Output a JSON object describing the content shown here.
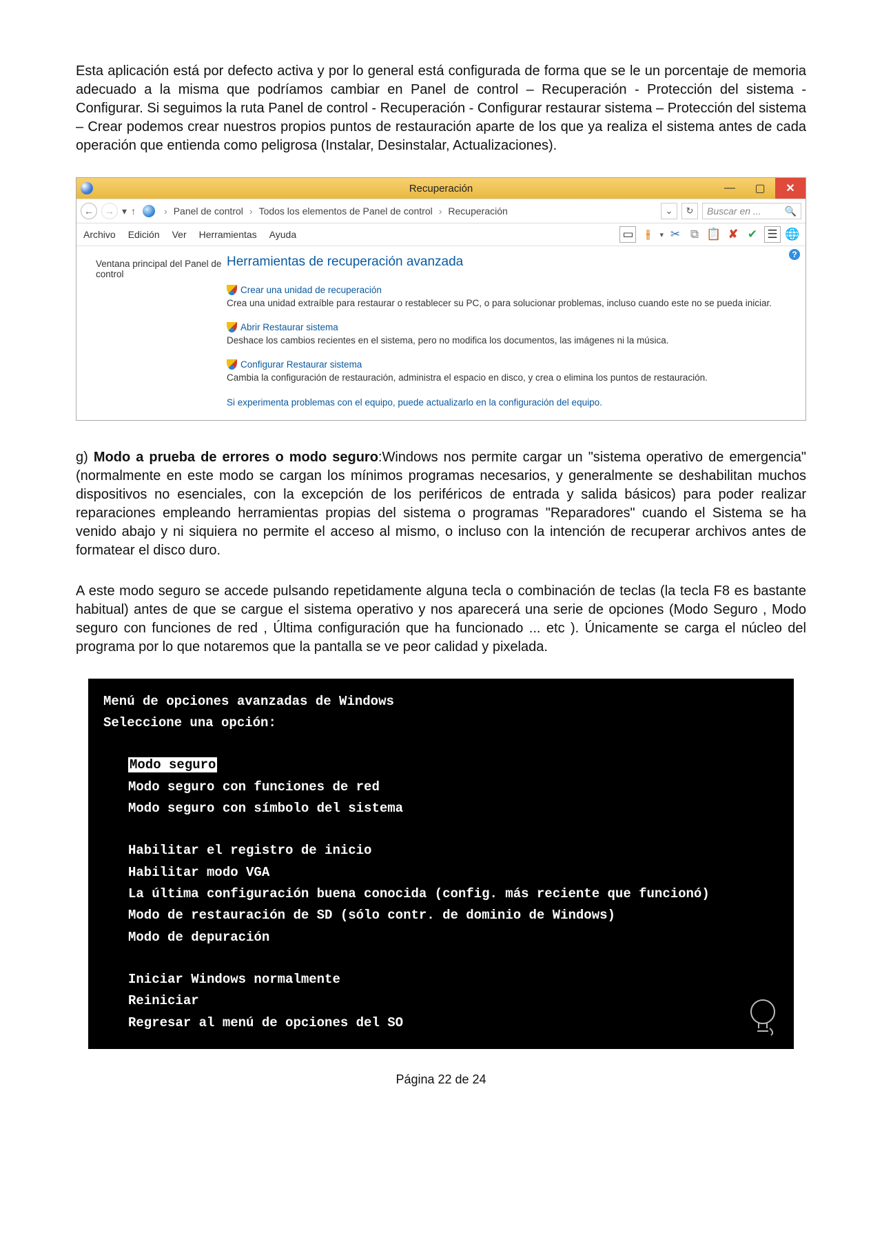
{
  "para1": "Esta aplicación está por defecto activa y por lo general está configurada de forma que se le un porcentaje de memoria adecuado a la misma que podríamos cambiar en Panel de control – Recuperación - Protección del sistema - Configurar. Si seguimos la ruta  Panel de control - Recuperación - Configurar restaurar sistema – Protección del sistema – Crear podemos crear nuestros propios puntos de restauración aparte de los que ya realiza el sistema  antes de cada operación que entienda como peligrosa (Instalar, Desinstalar, Actualizaciones).",
  "window": {
    "title": "Recuperación",
    "breadcrumb": {
      "p1": "Panel de control",
      "p2": "Todos los elementos de Panel de control",
      "p3": "Recuperación"
    },
    "search_placeholder": "Buscar en ...",
    "menu": {
      "archivo": "Archivo",
      "edicion": "Edición",
      "ver": "Ver",
      "herramientas": "Herramientas",
      "ayuda": "Ayuda"
    },
    "left_link": "Ventana principal del Panel de control",
    "heading": "Herramientas de recuperación avanzada",
    "opt1": {
      "link": "Crear una unidad de recuperación",
      "desc": "Crea una unidad extraíble para restaurar o restablecer su PC, o para solucionar problemas, incluso cuando este no se pueda iniciar."
    },
    "opt2": {
      "link": "Abrir Restaurar sistema",
      "desc": "Deshace los cambios recientes en el sistema, pero no modifica los documentos, las imágenes ni la música."
    },
    "opt3": {
      "link": "Configurar Restaurar sistema",
      "desc": "Cambia la configuración de restauración, administra el espacio en disco, y crea o elimina los puntos de restauración."
    },
    "footer_link": "Si experimenta problemas con el equipo, puede actualizarlo en la configuración del equipo."
  },
  "para2": {
    "prefix": "g) ",
    "bold": "Modo a prueba de errores o modo seguro",
    "rest": ":Windows nos permite cargar un \"sistema operativo de emergencia\" (normalmente en este modo se cargan los mínimos programas necesarios, y generalmente se deshabilitan muchos dispositivos no esenciales, con la excepción de los periféricos de entrada y salida básicos) para poder realizar reparaciones empleando herramientas propias del sistema o programas \"Reparadores\" cuando el Sistema se ha venido abajo y ni siquiera no permite el acceso al mismo, o incluso con la intención de recuperar archivos antes de formatear el disco duro."
  },
  "para3": "A este modo seguro se accede pulsando repetidamente alguna tecla o combinación de teclas (la tecla F8 es bastante habitual) antes de que se cargue el sistema operativo y nos aparecerá una serie de opciones (Modo Seguro , Modo seguro con funciones de red , Última configuración que ha funcionado ... etc ). Únicamente se carga el núcleo del programa por lo que notaremos que la pantalla se ve peor calidad y pixelada.",
  "console": {
    "l1": "Menú de opciones avanzadas de Windows",
    "l2": "Seleccione una opción:",
    "o1": "Modo seguro",
    "o2": "Modo seguro con funciones de red",
    "o3": "Modo seguro con símbolo del sistema",
    "o4": "Habilitar el registro de inicio",
    "o5": "Habilitar modo VGA",
    "o6": "La última configuración buena conocida (config. más reciente que funcionó)",
    "o7": "Modo de restauración de SD (sólo contr. de dominio de Windows)",
    "o8": "Modo de depuración",
    "o9": "Iniciar Windows normalmente",
    "o10": "Reiniciar",
    "o11": "Regresar al menú de opciones del SO"
  },
  "footer": "Página 22 de 24"
}
